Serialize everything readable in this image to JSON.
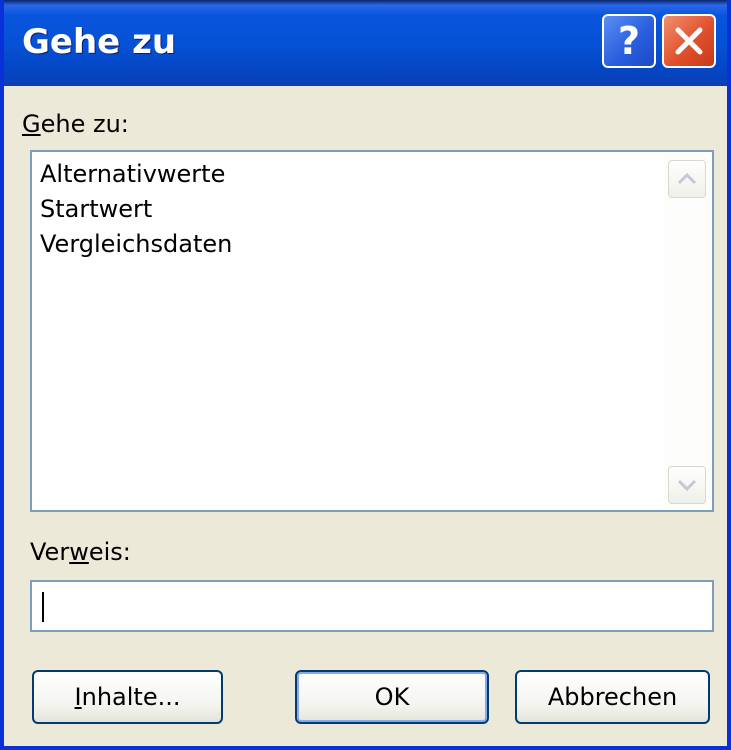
{
  "window": {
    "title": "Gehe zu",
    "help_label": "?",
    "accent_color": "#0652d6",
    "close_color": "#e0502c"
  },
  "goto": {
    "label_first": "G",
    "label_rest": "ehe zu:",
    "items": [
      "Alternativwerte",
      "Startwert",
      "Vergleichsdaten"
    ]
  },
  "reference": {
    "label_first": "Ver",
    "label_u": "w",
    "label_rest": "eis:",
    "value": ""
  },
  "buttons": {
    "contents_first": "I",
    "contents_rest": "nhalte...",
    "ok": "OK",
    "cancel": "Abbrechen"
  },
  "icons": {
    "help": "help-icon",
    "close": "close-icon",
    "scroll_up": "chevron-up-icon",
    "scroll_down": "chevron-down-icon"
  }
}
